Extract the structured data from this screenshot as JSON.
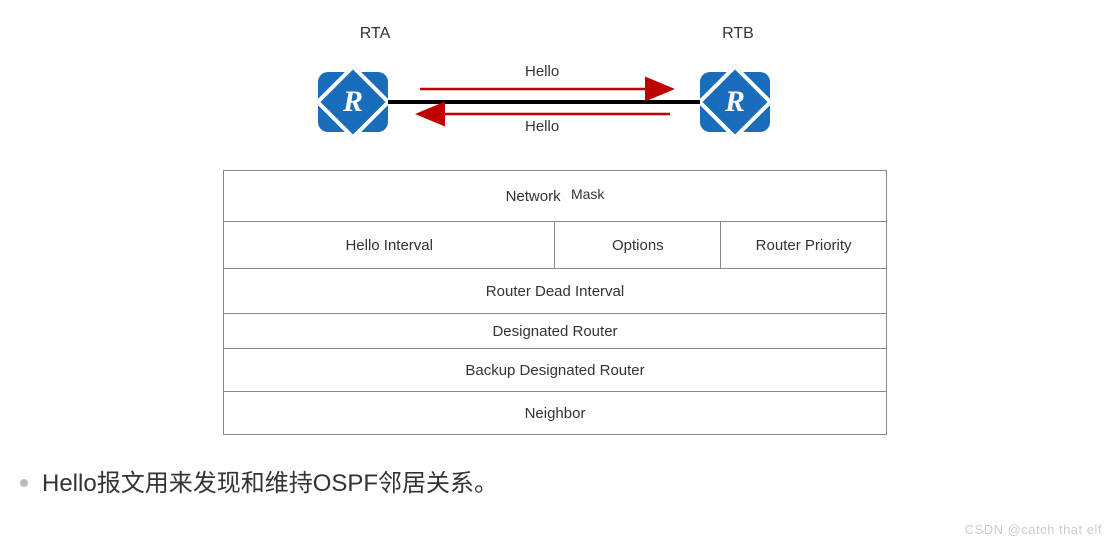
{
  "diagram": {
    "left_router": "RTA",
    "right_router": "RTB",
    "router_glyph": "R",
    "top_msg": "Hello",
    "bottom_msg": "Hello"
  },
  "packet": {
    "row1_col1": "Network",
    "row1_col2": "Mask",
    "row2_col1": "Hello Interval",
    "row2_col2": "Options",
    "row2_col3": "Router Priority",
    "row3": "Router Dead Interval",
    "row4": "Designated Router",
    "row5": "Backup Designated Router",
    "row6": "Neighbor"
  },
  "bullet": "Hello报文用来发现和维持OSPF邻居关系。",
  "watermark": "CSDN @catch that elf"
}
